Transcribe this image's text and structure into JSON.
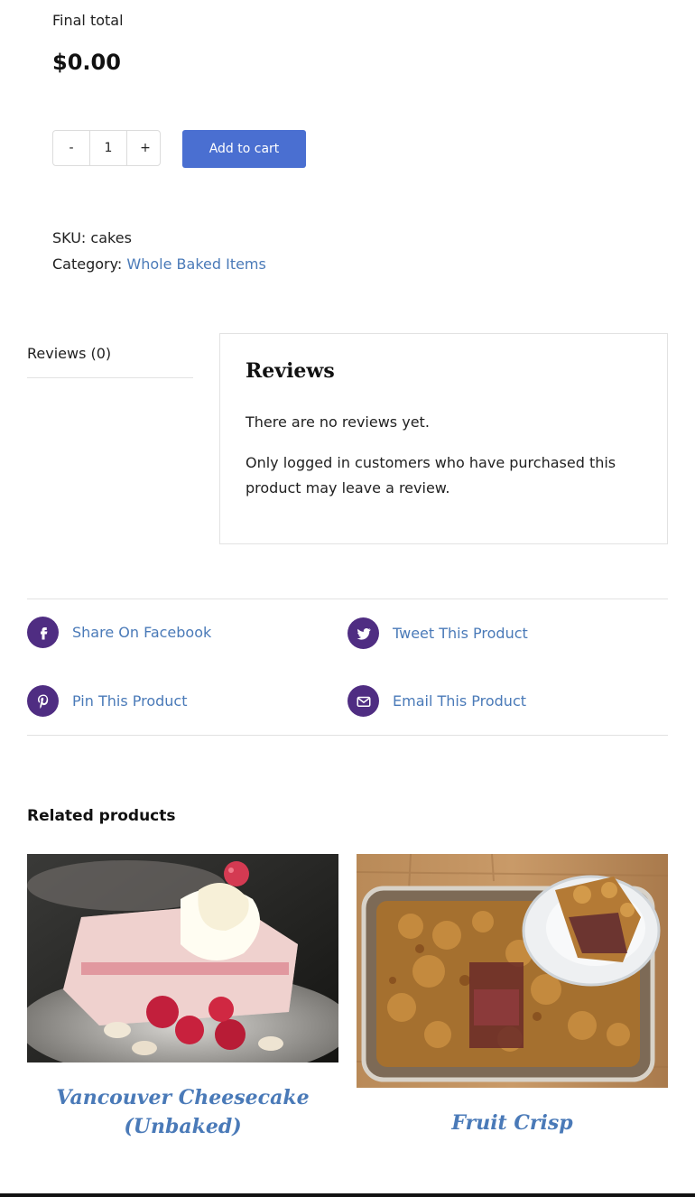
{
  "summary": {
    "final_total_label": "Final total",
    "final_total_value": "$0.00"
  },
  "cart": {
    "minus_label": "-",
    "quantity": "1",
    "plus_label": "+",
    "add_to_cart_label": "Add to cart"
  },
  "meta": {
    "sku_label": "SKU:",
    "sku_value": "cakes",
    "category_label": "Category:",
    "category_value": "Whole Baked Items"
  },
  "tabs": {
    "reviews_tab_label": "Reviews (0)"
  },
  "reviews": {
    "title": "Reviews",
    "no_reviews_text": "There are no reviews yet.",
    "notice_text": "Only logged in customers who have purchased this product may leave a review."
  },
  "share": {
    "facebook_label": "Share On Facebook",
    "twitter_label": "Tweet This Product",
    "pinterest_label": "Pin This Product",
    "email_label": "Email This Product",
    "icon_color": "#4f2d82"
  },
  "related": {
    "title": "Related products",
    "products": [
      {
        "name": "Vancouver Cheesecake (Unbaked)",
        "image_icon": "cheesecake-photo"
      },
      {
        "name": "Fruit Crisp",
        "image_icon": "fruit-crisp-photo"
      }
    ]
  },
  "colors": {
    "accent_button": "#4a6fd1",
    "link": "#4a7ab8"
  }
}
